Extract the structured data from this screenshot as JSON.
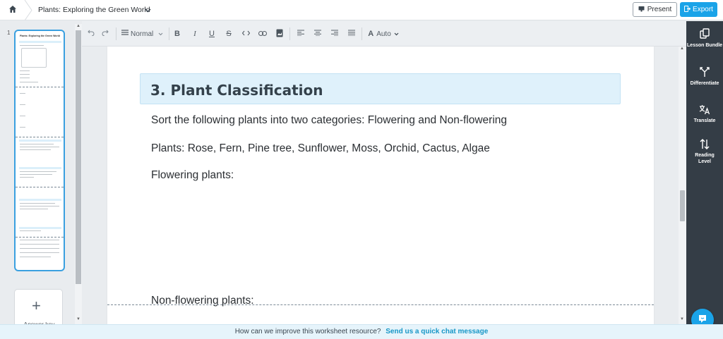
{
  "app": {
    "title": "Plants: Exploring the Green World",
    "present_label": "Present",
    "export_label": "Export"
  },
  "toolbar": {
    "style_label": "Normal",
    "font_size_label": "Auto"
  },
  "thumbnails": {
    "page_number": "1",
    "add_label": "Answer key"
  },
  "document": {
    "section_title": "3. Plant Classification",
    "instruction": "Sort the following plants into two categories: Flowering and Non-flowering",
    "plants": "Plants: Rose, Fern, Pine tree, Sunflower, Moss, Orchid, Cactus, Algae",
    "flowering_label": "Flowering plants:",
    "nonflowering_label": "Non-flowering plants:"
  },
  "right_panel": {
    "items": [
      {
        "label": "Lesson Bundle",
        "icon": "lesson-bundle-icon"
      },
      {
        "label": "Differentiate",
        "icon": "differentiate-icon"
      },
      {
        "label": "Translate",
        "icon": "translate-icon"
      },
      {
        "label": "Reading Level",
        "icon": "reading-level-icon"
      }
    ]
  },
  "footer": {
    "question": "How can we improve this worksheet resource?",
    "link": "Send us a quick chat message"
  },
  "colors": {
    "accent": "#1aa3e8",
    "sidebar": "#343d46",
    "section_banner": "#dff1fb"
  }
}
